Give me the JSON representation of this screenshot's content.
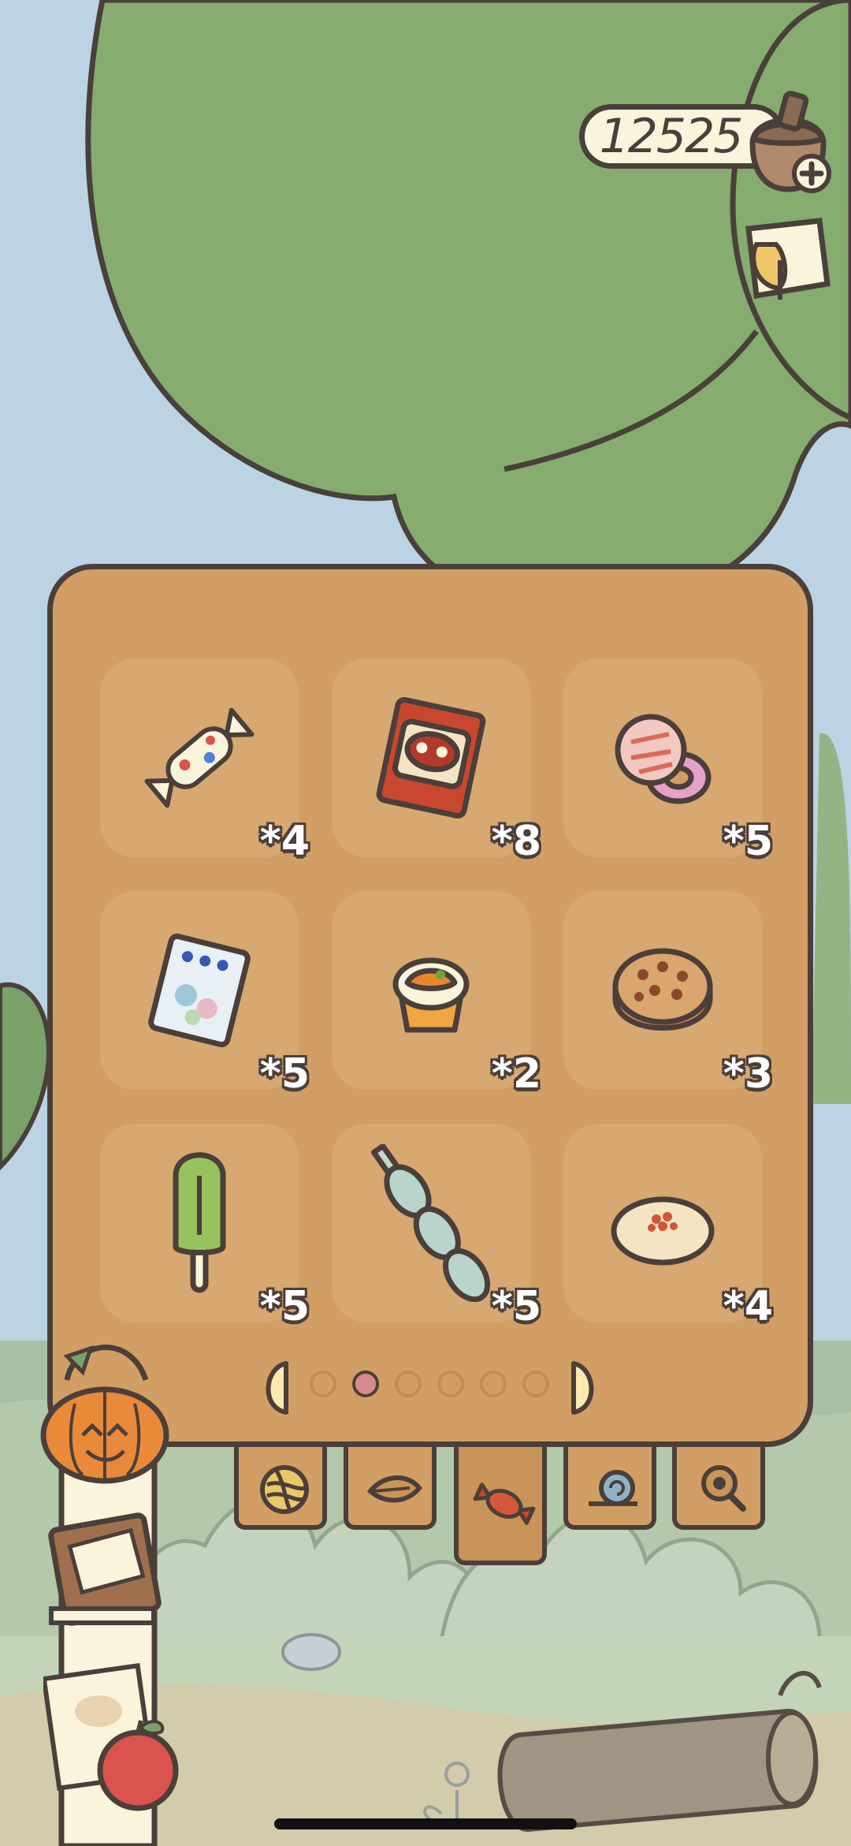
{
  "currency": {
    "clover_count": "12525",
    "plus_icon": "plus-icon"
  },
  "inventory": {
    "items": [
      {
        "name": "wrapped-candy",
        "count": "*4"
      },
      {
        "name": "cracker-pack",
        "count": "*8"
      },
      {
        "name": "pacifier-candy",
        "count": "*5"
      },
      {
        "name": "bead-candy-pack",
        "count": "*5"
      },
      {
        "name": "cupcake",
        "count": "*2"
      },
      {
        "name": "dorayaki",
        "count": "*3"
      },
      {
        "name": "green-popsicle",
        "count": "*5"
      },
      {
        "name": "dango-stick",
        "count": "*5"
      },
      {
        "name": "sweet-bun",
        "count": "*4"
      }
    ],
    "pager": {
      "total_pages": 6,
      "current_page": 2
    }
  },
  "tabs": [
    {
      "name": "yarn",
      "icon": "yarn-ball-icon",
      "active": false
    },
    {
      "name": "leaf",
      "icon": "leaf-icon",
      "active": false
    },
    {
      "name": "candy",
      "icon": "candy-icon",
      "active": true
    },
    {
      "name": "snail",
      "icon": "snail-icon",
      "active": false
    },
    {
      "name": "magnifier",
      "icon": "magnifier-icon",
      "active": false
    }
  ],
  "colors": {
    "panel": "#d19f65",
    "outline": "#4a3f3a",
    "foliage": "#86ac70",
    "sky": "#bcd3e4"
  }
}
